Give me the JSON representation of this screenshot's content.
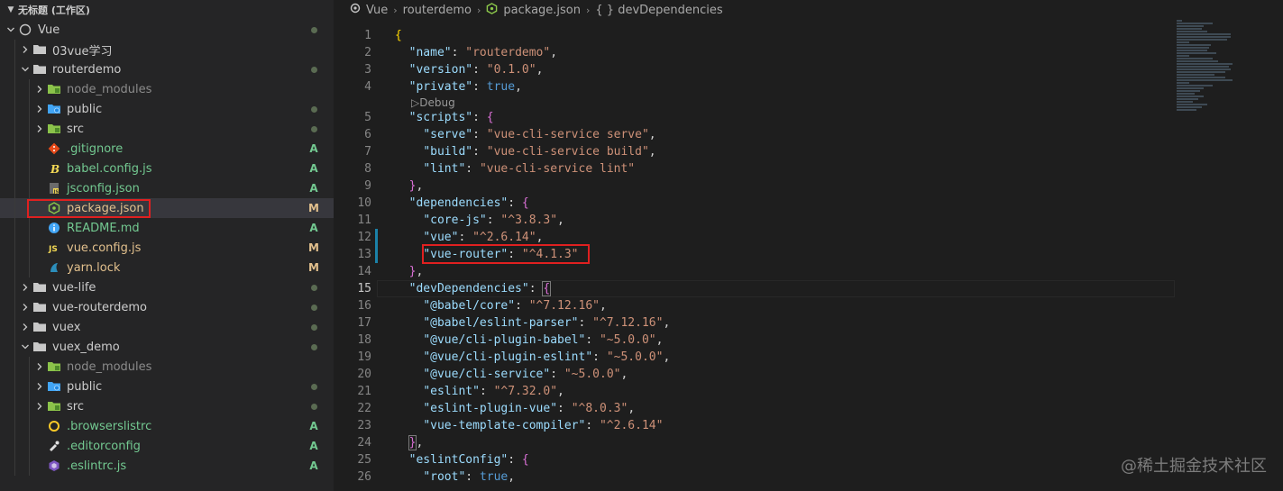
{
  "workspace": {
    "title": "无标题 (工作区)"
  },
  "tree": [
    {
      "label": "Vue",
      "depth": 0,
      "kind": "root-folder",
      "expanded": true,
      "status": "dot",
      "tone": "norm"
    },
    {
      "label": "03vue学习",
      "depth": 1,
      "kind": "folder",
      "expanded": false,
      "status": "",
      "tone": "norm"
    },
    {
      "label": "routerdemo",
      "depth": 1,
      "kind": "folder",
      "expanded": true,
      "status": "dot",
      "tone": "norm"
    },
    {
      "label": "node_modules",
      "depth": 2,
      "kind": "folder-green",
      "expanded": false,
      "status": "",
      "tone": "dim"
    },
    {
      "label": "public",
      "depth": 2,
      "kind": "folder-blue",
      "expanded": false,
      "status": "dot",
      "tone": "norm"
    },
    {
      "label": "src",
      "depth": 2,
      "kind": "folder-green",
      "expanded": false,
      "status": "dot",
      "tone": "norm"
    },
    {
      "label": ".gitignore",
      "depth": 2,
      "kind": "git-file",
      "status": "A",
      "tone": "A"
    },
    {
      "label": "babel.config.js",
      "depth": 2,
      "kind": "babel-file",
      "status": "A",
      "tone": "A"
    },
    {
      "label": "jsconfig.json",
      "depth": 2,
      "kind": "json-file",
      "status": "A",
      "tone": "A"
    },
    {
      "label": "package.json",
      "depth": 2,
      "kind": "node-file",
      "status": "M",
      "tone": "M",
      "selected": true
    },
    {
      "label": "README.md",
      "depth": 2,
      "kind": "info-file",
      "status": "A",
      "tone": "A"
    },
    {
      "label": "vue.config.js",
      "depth": 2,
      "kind": "vue-file",
      "status": "M",
      "tone": "M"
    },
    {
      "label": "yarn.lock",
      "depth": 2,
      "kind": "yarn-file",
      "status": "M",
      "tone": "M"
    },
    {
      "label": "vue-life",
      "depth": 1,
      "kind": "folder",
      "expanded": false,
      "status": "dot",
      "tone": "norm"
    },
    {
      "label": "vue-routerdemo",
      "depth": 1,
      "kind": "folder",
      "expanded": false,
      "status": "dot",
      "tone": "norm"
    },
    {
      "label": "vuex",
      "depth": 1,
      "kind": "folder",
      "expanded": false,
      "status": "dot",
      "tone": "norm"
    },
    {
      "label": "vuex_demo",
      "depth": 1,
      "kind": "folder",
      "expanded": true,
      "status": "dot",
      "tone": "norm"
    },
    {
      "label": "node_modules",
      "depth": 2,
      "kind": "folder-green",
      "expanded": false,
      "status": "",
      "tone": "dim"
    },
    {
      "label": "public",
      "depth": 2,
      "kind": "folder-blue",
      "expanded": false,
      "status": "dot",
      "tone": "norm"
    },
    {
      "label": "src",
      "depth": 2,
      "kind": "folder-green",
      "expanded": false,
      "status": "dot",
      "tone": "norm"
    },
    {
      "label": ".browserslistrc",
      "depth": 2,
      "kind": "ring-file",
      "status": "A",
      "tone": "A"
    },
    {
      "label": ".editorconfig",
      "depth": 2,
      "kind": "editorconfig-file",
      "status": "A",
      "tone": "A"
    },
    {
      "label": ".eslintrc.js",
      "depth": 2,
      "kind": "eslint-file",
      "status": "A",
      "tone": "A"
    }
  ],
  "breadcrumb": [
    "Vue",
    "routerdemo",
    "package.json",
    "{ } devDependencies"
  ],
  "codelens": "Debug",
  "code": [
    {
      "n": "1",
      "t": [
        [
          "b1",
          "{"
        ]
      ]
    },
    {
      "n": "2",
      "t": [
        [
          "p",
          "  "
        ],
        [
          "k",
          "\"name\""
        ],
        [
          "p",
          ": "
        ],
        [
          "s",
          "\"routerdemo\""
        ],
        [
          "p",
          ","
        ]
      ]
    },
    {
      "n": "3",
      "t": [
        [
          "p",
          "  "
        ],
        [
          "k",
          "\"version\""
        ],
        [
          "p",
          ": "
        ],
        [
          "s",
          "\"0.1.0\""
        ],
        [
          "p",
          ","
        ]
      ]
    },
    {
      "n": "4",
      "t": [
        [
          "p",
          "  "
        ],
        [
          "k",
          "\"private\""
        ],
        [
          "p",
          ": "
        ],
        [
          "kw",
          "true"
        ],
        [
          "p",
          ","
        ]
      ]
    },
    {
      "n": "5",
      "t": [
        [
          "p",
          "  "
        ],
        [
          "k",
          "\"scripts\""
        ],
        [
          "p",
          ": "
        ],
        [
          "b2",
          "{"
        ]
      ]
    },
    {
      "n": "6",
      "t": [
        [
          "p",
          "    "
        ],
        [
          "k",
          "\"serve\""
        ],
        [
          "p",
          ": "
        ],
        [
          "s",
          "\"vue-cli-service serve\""
        ],
        [
          "p",
          ","
        ]
      ]
    },
    {
      "n": "7",
      "t": [
        [
          "p",
          "    "
        ],
        [
          "k",
          "\"build\""
        ],
        [
          "p",
          ": "
        ],
        [
          "s",
          "\"vue-cli-service build\""
        ],
        [
          "p",
          ","
        ]
      ]
    },
    {
      "n": "8",
      "t": [
        [
          "p",
          "    "
        ],
        [
          "k",
          "\"lint\""
        ],
        [
          "p",
          ": "
        ],
        [
          "s",
          "\"vue-cli-service lint\""
        ]
      ]
    },
    {
      "n": "9",
      "t": [
        [
          "p",
          "  "
        ],
        [
          "b2",
          "}"
        ],
        [
          "p",
          ","
        ]
      ]
    },
    {
      "n": "10",
      "t": [
        [
          "p",
          "  "
        ],
        [
          "k",
          "\"dependencies\""
        ],
        [
          "p",
          ": "
        ],
        [
          "b2",
          "{"
        ]
      ]
    },
    {
      "n": "11",
      "t": [
        [
          "p",
          "    "
        ],
        [
          "k",
          "\"core-js\""
        ],
        [
          "p",
          ": "
        ],
        [
          "s",
          "\"^3.8.3\""
        ],
        [
          "p",
          ","
        ]
      ]
    },
    {
      "n": "12",
      "t": [
        [
          "p",
          "    "
        ],
        [
          "k",
          "\"vue\""
        ],
        [
          "p",
          ": "
        ],
        [
          "s",
          "\"^2.6.14\""
        ],
        [
          "p",
          ","
        ]
      ]
    },
    {
      "n": "13",
      "t": [
        [
          "p",
          "    "
        ],
        [
          "k",
          "\"vue-router\""
        ],
        [
          "p",
          ": "
        ],
        [
          "s",
          "\"^4.1.3\""
        ]
      ]
    },
    {
      "n": "14",
      "t": [
        [
          "p",
          "  "
        ],
        [
          "b2",
          "}"
        ],
        [
          "p",
          ","
        ]
      ]
    },
    {
      "n": "15",
      "t": [
        [
          "p",
          "  "
        ],
        [
          "k",
          "\"devDependencies\""
        ],
        [
          "p",
          ": "
        ],
        [
          "b2",
          "{"
        ]
      ]
    },
    {
      "n": "16",
      "t": [
        [
          "p",
          "    "
        ],
        [
          "k",
          "\"@babel/core\""
        ],
        [
          "p",
          ": "
        ],
        [
          "s",
          "\"^7.12.16\""
        ],
        [
          "p",
          ","
        ]
      ]
    },
    {
      "n": "17",
      "t": [
        [
          "p",
          "    "
        ],
        [
          "k",
          "\"@babel/eslint-parser\""
        ],
        [
          "p",
          ": "
        ],
        [
          "s",
          "\"^7.12.16\""
        ],
        [
          "p",
          ","
        ]
      ]
    },
    {
      "n": "18",
      "t": [
        [
          "p",
          "    "
        ],
        [
          "k",
          "\"@vue/cli-plugin-babel\""
        ],
        [
          "p",
          ": "
        ],
        [
          "s",
          "\"~5.0.0\""
        ],
        [
          "p",
          ","
        ]
      ]
    },
    {
      "n": "19",
      "t": [
        [
          "p",
          "    "
        ],
        [
          "k",
          "\"@vue/cli-plugin-eslint\""
        ],
        [
          "p",
          ": "
        ],
        [
          "s",
          "\"~5.0.0\""
        ],
        [
          "p",
          ","
        ]
      ]
    },
    {
      "n": "20",
      "t": [
        [
          "p",
          "    "
        ],
        [
          "k",
          "\"@vue/cli-service\""
        ],
        [
          "p",
          ": "
        ],
        [
          "s",
          "\"~5.0.0\""
        ],
        [
          "p",
          ","
        ]
      ]
    },
    {
      "n": "21",
      "t": [
        [
          "p",
          "    "
        ],
        [
          "k",
          "\"eslint\""
        ],
        [
          "p",
          ": "
        ],
        [
          "s",
          "\"^7.32.0\""
        ],
        [
          "p",
          ","
        ]
      ]
    },
    {
      "n": "22",
      "t": [
        [
          "p",
          "    "
        ],
        [
          "k",
          "\"eslint-plugin-vue\""
        ],
        [
          "p",
          ": "
        ],
        [
          "s",
          "\"^8.0.3\""
        ],
        [
          "p",
          ","
        ]
      ]
    },
    {
      "n": "23",
      "t": [
        [
          "p",
          "    "
        ],
        [
          "k",
          "\"vue-template-compiler\""
        ],
        [
          "p",
          ": "
        ],
        [
          "s",
          "\"^2.6.14\""
        ]
      ]
    },
    {
      "n": "24",
      "t": [
        [
          "p",
          "  "
        ],
        [
          "b2",
          "}"
        ],
        [
          "p",
          ","
        ]
      ]
    },
    {
      "n": "25",
      "t": [
        [
          "p",
          "  "
        ],
        [
          "k",
          "\"eslintConfig\""
        ],
        [
          "p",
          ": "
        ],
        [
          "b2",
          "{"
        ]
      ]
    },
    {
      "n": "26",
      "t": [
        [
          "p",
          "    "
        ],
        [
          "k",
          "\"root\""
        ],
        [
          "p",
          ": "
        ],
        [
          "kw",
          "true"
        ],
        [
          "p",
          ","
        ]
      ]
    }
  ],
  "active_line": "15",
  "watermark": "@稀土掘金技术社区",
  "colors": {
    "added": "#73c991",
    "modified": "#e2c08d",
    "highlight_box": "#e02020",
    "key": "#9cdcfe",
    "string": "#ce9178"
  }
}
